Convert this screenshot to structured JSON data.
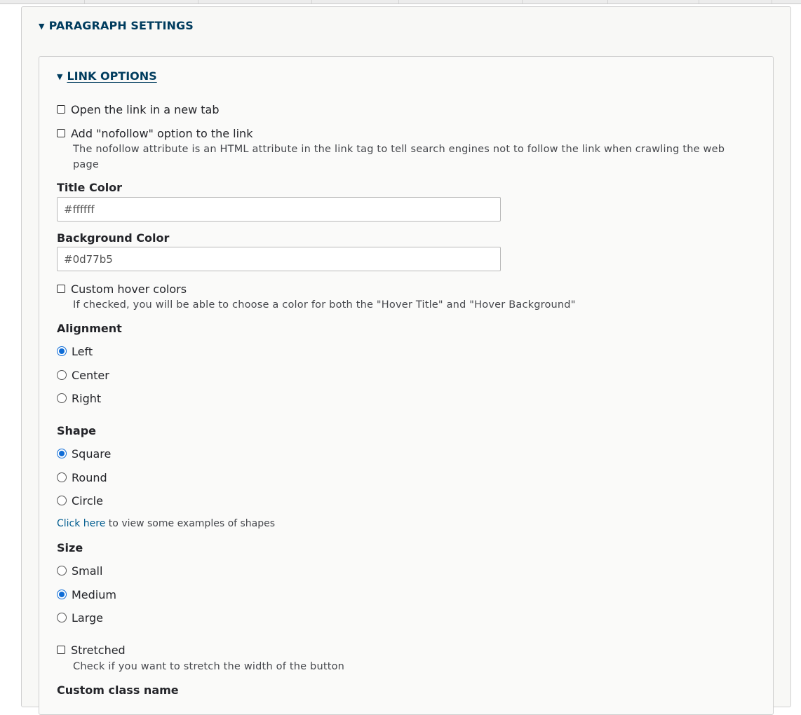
{
  "outer": {
    "title": "PARAGRAPH SETTINGS"
  },
  "inner": {
    "title": "LINK OPTIONS"
  },
  "new_tab": {
    "label": "Open the link in a new tab"
  },
  "nofollow": {
    "label": "Add \"nofollow\" option to the link",
    "desc_line1": "The nofollow attribute is an HTML attribute in the link tag to tell search engines not to follow the link when crawling the web",
    "desc_line2": "page"
  },
  "title_color": {
    "label": "Title Color",
    "value": "#ffffff"
  },
  "background_color": {
    "label": "Background Color",
    "value": "#0d77b5"
  },
  "custom_hover": {
    "label": "Custom hover colors",
    "desc": "If checked, you will be able to choose a color for both the \"Hover Title\" and \"Hover Background\""
  },
  "alignment": {
    "label": "Alignment",
    "options": [
      "Left",
      "Center",
      "Right"
    ],
    "selected": "Left"
  },
  "shape": {
    "label": "Shape",
    "options": [
      "Square",
      "Round",
      "Circle"
    ],
    "selected": "Square",
    "helper_link": "Click here",
    "helper_text": " to view some examples of shapes"
  },
  "size": {
    "label": "Size",
    "options": [
      "Small",
      "Medium",
      "Large"
    ],
    "selected": "Medium"
  },
  "stretched": {
    "label": "Stretched",
    "desc": "Check if you want to stretch the width of the button"
  },
  "custom_class": {
    "label": "Custom class name"
  },
  "colors": {
    "accent": "#0f6cd6",
    "heading": "#003c5e",
    "link": "#005c8f"
  }
}
